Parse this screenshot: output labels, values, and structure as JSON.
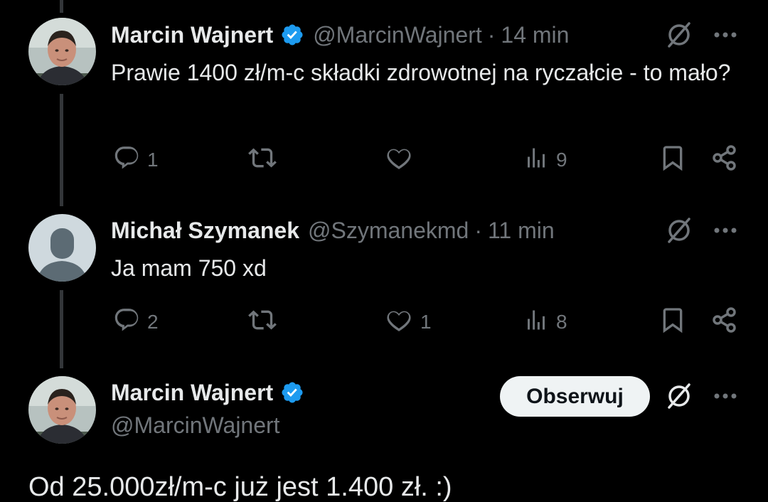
{
  "tweets": [
    {
      "name": "Marcin Wajnert",
      "handle": "@MarcinWajnert",
      "separator": "·",
      "time": "14 min",
      "text": "Prawie 1400 zł/m-c składki zdrowotnej na ryczałcie - to mało?",
      "replies": "1",
      "retweets": "",
      "likes": "",
      "views": "9"
    },
    {
      "name": "Michał Szymanek",
      "handle": "@Szymanekmd",
      "separator": "·",
      "time": "11 min",
      "text": "Ja mam 750 xd",
      "replies": "2",
      "retweets": "",
      "likes": "1",
      "views": "8"
    }
  ],
  "main_tweet": {
    "name": "Marcin Wajnert",
    "handle": "@MarcinWajnert",
    "follow_label": "Obserwuj",
    "text": "Od 25.000zł/m-c już jest 1.400 zł. :)"
  },
  "icons": {
    "verified": "verified-badge-icon",
    "grok": "grok-icon",
    "more": "more-icon",
    "reply": "reply-icon",
    "retweet": "retweet-icon",
    "like": "like-icon",
    "views": "views-icon",
    "bookmark": "bookmark-icon",
    "share": "share-icon"
  },
  "colors": {
    "background": "#000000",
    "text": "#e7e9ea",
    "secondary": "#71767b",
    "verified": "#1d9bf0",
    "thread_line": "#333639",
    "follow_bg": "#eff3f4"
  }
}
